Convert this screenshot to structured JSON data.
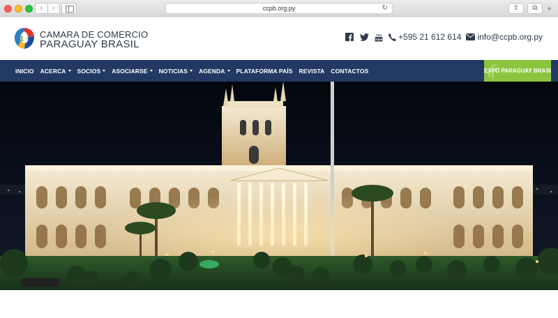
{
  "browser": {
    "url": "ccpb.org.py",
    "back_glyph": "‹",
    "forward_glyph": "›",
    "reload_glyph": "↻",
    "share_glyph": "⇪",
    "tabs_glyph": "⧉",
    "newtab_glyph": "+"
  },
  "header": {
    "brand_line1": "CAMARA DE COMERCIO",
    "brand_line2": "PARAGUAY BRASIL",
    "social_icons": [
      "facebook-icon",
      "twitter-icon",
      "youtube-icon"
    ],
    "phone": "+595 21 612 614",
    "email": "info@ccpb.org.py"
  },
  "nav": {
    "items": [
      {
        "label": "INICIO",
        "dropdown": false
      },
      {
        "label": "ACERCA",
        "dropdown": true
      },
      {
        "label": "SOCIOS",
        "dropdown": true
      },
      {
        "label": "ASOCIARSE",
        "dropdown": true
      },
      {
        "label": "NOTICIAS",
        "dropdown": true
      },
      {
        "label": "AGENDA",
        "dropdown": true
      },
      {
        "label": "PLATAFORMA PAÍS",
        "dropdown": false
      },
      {
        "label": "REVISTA",
        "dropdown": false
      },
      {
        "label": "CONTACTOS",
        "dropdown": false
      }
    ],
    "cta": "EXPO PARAGUAY BRASIL"
  },
  "colors": {
    "nav_bg": "#223a63",
    "cta_bg": "#8bc53f",
    "text_dark": "#2f3a4b"
  }
}
